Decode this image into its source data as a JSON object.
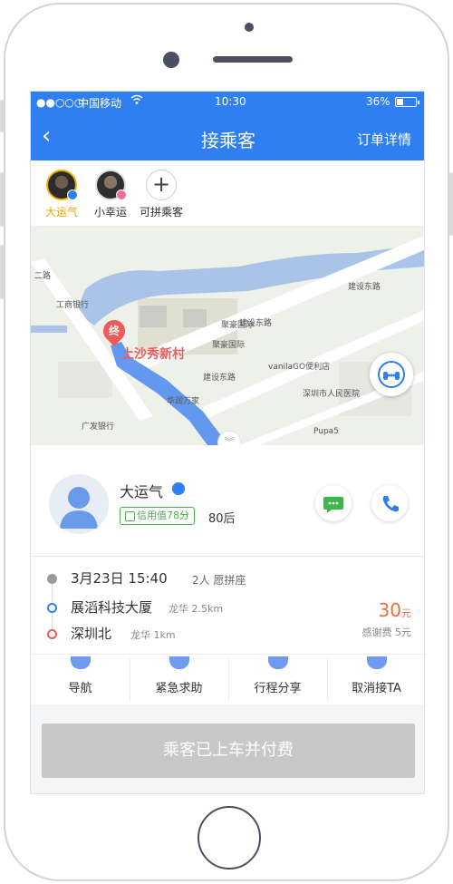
{
  "status_bar": {
    "signal": "●●○○○",
    "carrier": "中国移动",
    "time": "10:30",
    "battery_pct": "36%",
    "battery_level": 0.36
  },
  "nav": {
    "back_icon": "chevron-left",
    "back_glyph": "‹",
    "title": "接乘客",
    "detail_label": "订单详情"
  },
  "passenger_tabs": [
    {
      "label": "大运气",
      "active": true,
      "badge_color": "#2f7ff0"
    },
    {
      "label": "小幸运",
      "active": false,
      "badge_color": "#f06c9b"
    },
    {
      "label": "可拼乘客",
      "plus_glyph": "+"
    }
  ],
  "map": {
    "destination_pin_glyph": "终",
    "destination_label": "上沙秀新村",
    "road_labels": [
      "建设东路",
      "建设东路",
      "建设东路",
      "二路"
    ],
    "poi_labels": [
      "聚豪国际",
      "聚豪国际",
      "工商银行",
      "vanilaGO便利店",
      "Pupa5",
      "华润万家",
      "深圳市人民医院",
      "广发银行"
    ],
    "collapse_glyph": "︾",
    "colors": {
      "water": "#a9c4e8",
      "route": "#4a88f0",
      "road": "#ffffff",
      "block": "#d9dbd3"
    }
  },
  "passenger": {
    "name": "大运气",
    "credit_label": "信用值78分",
    "age_group": "80后",
    "chat_icon": "message-icon",
    "phone_icon": "phone-icon"
  },
  "trip": {
    "datetime": "3月23日  15:40",
    "seats_note": "2人  愿拼座",
    "origin": "展滔科技大厦",
    "origin_detail": "龙华  2.5km",
    "destination": "深圳北",
    "destination_detail": "龙华  1km",
    "fare_amount": "30",
    "fare_unit": "元",
    "thanks_fee": "感谢费  5元",
    "colors": {
      "fare": "#f26a3d",
      "origin_dot": "#2f7ff0",
      "dest_dot": "#f05a5a",
      "time_dot": "#999999"
    }
  },
  "actions": [
    {
      "label": "导航",
      "icon": "navigation-icon"
    },
    {
      "label": "紧急求助",
      "icon": "emergency-icon"
    },
    {
      "label": "行程分享",
      "icon": "share-icon"
    },
    {
      "label": "取消接TA",
      "icon": "cancel-icon"
    }
  ],
  "primary_button": "乘客已上车并付费",
  "colors": {
    "brand": "#2f7ff0",
    "button_disabled": "#c8c8c8"
  }
}
